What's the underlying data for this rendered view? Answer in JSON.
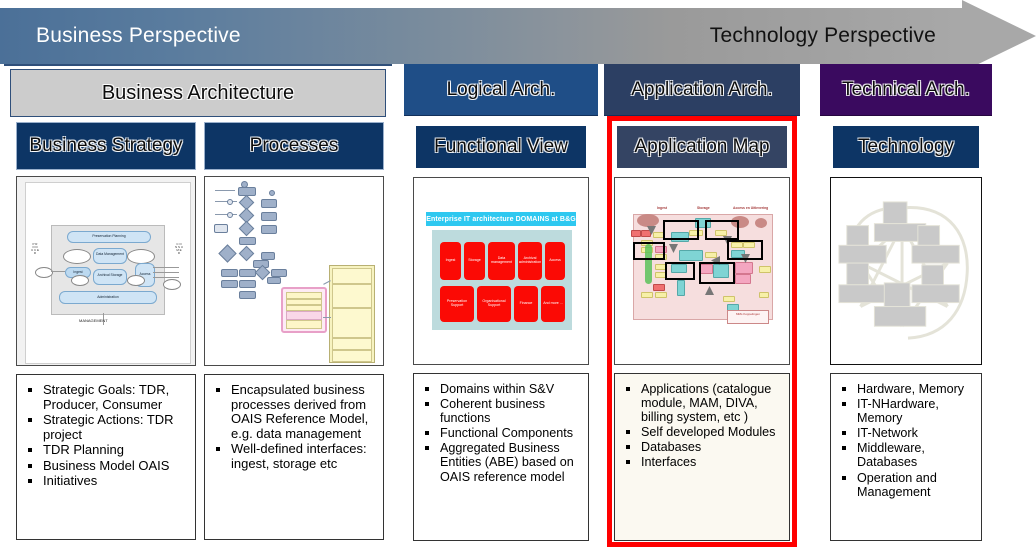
{
  "banner": {
    "left_label": "Business Perspective",
    "right_label": "Technology Perspective",
    "gradient_from": "#4b7098",
    "gradient_to": "#a8a8a8"
  },
  "columns": [
    {
      "id": "business",
      "title": "Business Architecture",
      "title_bg": "#cccccc",
      "panels": [
        {
          "sub_title": "Business Strategy",
          "thumbnail": "oais-reference-model-diagram",
          "bullets": [
            "Strategic Goals: TDR, Producer, Consumer",
            "Strategic Actions: TDR project",
            "TDR Planning",
            "Business Model OAIS",
            "Initiatives"
          ]
        },
        {
          "sub_title": "Processes",
          "thumbnail": "process-flowchart-diagram",
          "bullets": [
            "Encapsulated business processes derived from OAIS Reference Model, e.g. data management",
            "Well-defined interfaces: ingest, storage etc"
          ]
        }
      ]
    },
    {
      "id": "logical",
      "title": "Logical Arch.",
      "title_bg": "#1f4e87",
      "panels": [
        {
          "sub_title": "Functional View",
          "thumbnail": "enterprise-domains-diagram",
          "bullets": [
            "Domains within S&V",
            "Coherent  business functions",
            "Functional Components",
            "Aggregated Business  Entities (ABE) based  on OAIS reference model"
          ]
        }
      ]
    },
    {
      "id": "application",
      "title": "Application Arch.",
      "title_bg": "#2c3f63",
      "highlight_color": "#ff0000",
      "panels": [
        {
          "sub_title": "Application Map",
          "thumbnail": "application-landscape-map",
          "bullets": [
            "Applications (catalogue module, MAM, DIVA, billing system, etc )",
            "Self developed Modules",
            "Databases",
            "Interfaces"
          ]
        }
      ]
    },
    {
      "id": "technical",
      "title": "Technical Arch.",
      "title_bg": "#3a0a5f",
      "panels": [
        {
          "sub_title": "Technology",
          "thumbnail": "network-topology-diagram",
          "bullets": [
            "Hardware, Memory",
            "IT-NHardware, Memory",
            "IT-Network",
            "Middleware, Databases",
            "Operation and Management"
          ]
        }
      ]
    }
  ],
  "thumbnails": {
    "oais": {
      "caption": "MANAGEMENT",
      "boxes": [
        "Preservation Planning",
        "Data Management",
        "Ingest",
        "Archival Storage",
        "Access",
        "Administration"
      ],
      "packets": [
        "SIP",
        "AIP",
        "AIP",
        "DIP"
      ],
      "descriptive": [
        "Descriptive info",
        "Descriptive info"
      ],
      "left_axis": "PRODUCER",
      "right_axis": "CONSUMER",
      "access_lines": [
        "queries",
        "result sets",
        "orders"
      ]
    },
    "functional_view": {
      "banner": "Enterprise IT architecture DOMAINS at B&G",
      "row1": [
        "Ingest",
        "Storage",
        "Data management",
        "Archival administration",
        "Access"
      ],
      "row2": [
        "Preservation Support",
        "Organisational Support",
        "Finance",
        "And more ..."
      ]
    },
    "application_map": {
      "headers": [
        "Ingest",
        "Storage",
        "Access en Uitlevering"
      ],
      "legend": "MMs Koppelingen"
    }
  }
}
